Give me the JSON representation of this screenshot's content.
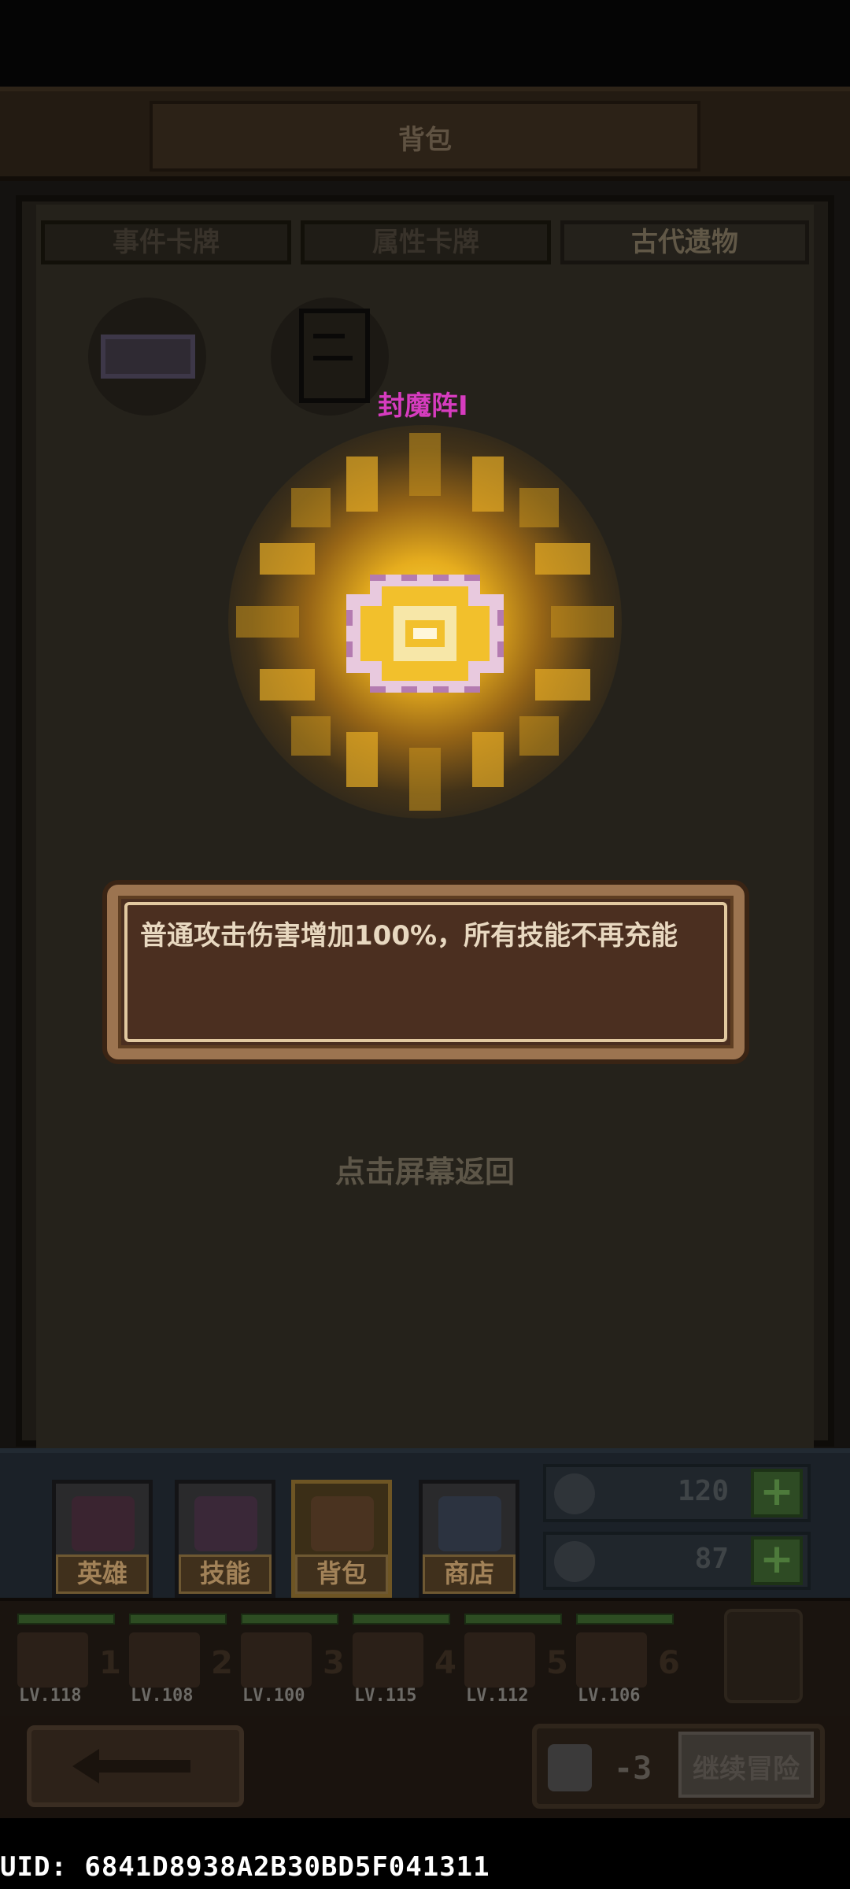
{
  "header": {
    "title": "背包"
  },
  "tabs": [
    {
      "label": "事件卡牌"
    },
    {
      "label": "属性卡牌"
    },
    {
      "label": "古代遗物"
    }
  ],
  "relic": {
    "name": "封魔阵I",
    "description": "普通攻击伤害增加100%，所有技能不再充能"
  },
  "hint": "点击屏幕返回",
  "menu": [
    {
      "label": "英雄"
    },
    {
      "label": "技能"
    },
    {
      "label": "背包"
    },
    {
      "label": "商店"
    }
  ],
  "resources": [
    {
      "icon": "clock-icon",
      "value": "120"
    },
    {
      "icon": "bottle-icon",
      "value": "87"
    }
  ],
  "party": [
    {
      "slot": "1",
      "level": "LV.118"
    },
    {
      "slot": "2",
      "level": "LV.108"
    },
    {
      "slot": "3",
      "level": "LV.100"
    },
    {
      "slot": "4",
      "level": "LV.115"
    },
    {
      "slot": "5",
      "level": "LV.112"
    },
    {
      "slot": "6",
      "level": "LV.106"
    }
  ],
  "footer": {
    "cost": "-3",
    "continue_label": "继续冒险"
  },
  "uid": "UID: 6841D8938A2B30BD5F041311",
  "colors": {
    "relic_name": "#d63cbf",
    "glow": "#f2c233",
    "desc_box": "#4b2f20"
  }
}
